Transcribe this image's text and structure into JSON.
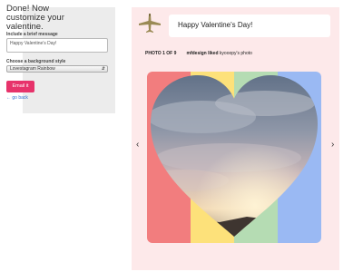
{
  "panel": {
    "title": "Done! Now customize your valentine.",
    "message_label": "Include a brief message",
    "message_value": "Happy Valentine's Day!",
    "style_label": "Choose a background style",
    "style_value": "Lovestagram Rainbow",
    "email_button": "Email it",
    "go_back": "← go back"
  },
  "card": {
    "message": "Happy Valentine's Day!",
    "photo_counter": "PHOTO 1 OF 9",
    "liker": "mfdesign",
    "liked_text": "liked",
    "photo_owner": "kyooopy's photo",
    "prev_arrow": "‹",
    "next_arrow": "›"
  },
  "colors": {
    "stripes": [
      "#f27d7e",
      "#fde17a",
      "#b5dcb3",
      "#9ab9f3"
    ],
    "email_button": "#e7336b",
    "card_bg": "#fde9ea"
  },
  "icons": {
    "plane": "airplane-icon",
    "prev": "chevron-left-icon",
    "next": "chevron-right-icon"
  }
}
